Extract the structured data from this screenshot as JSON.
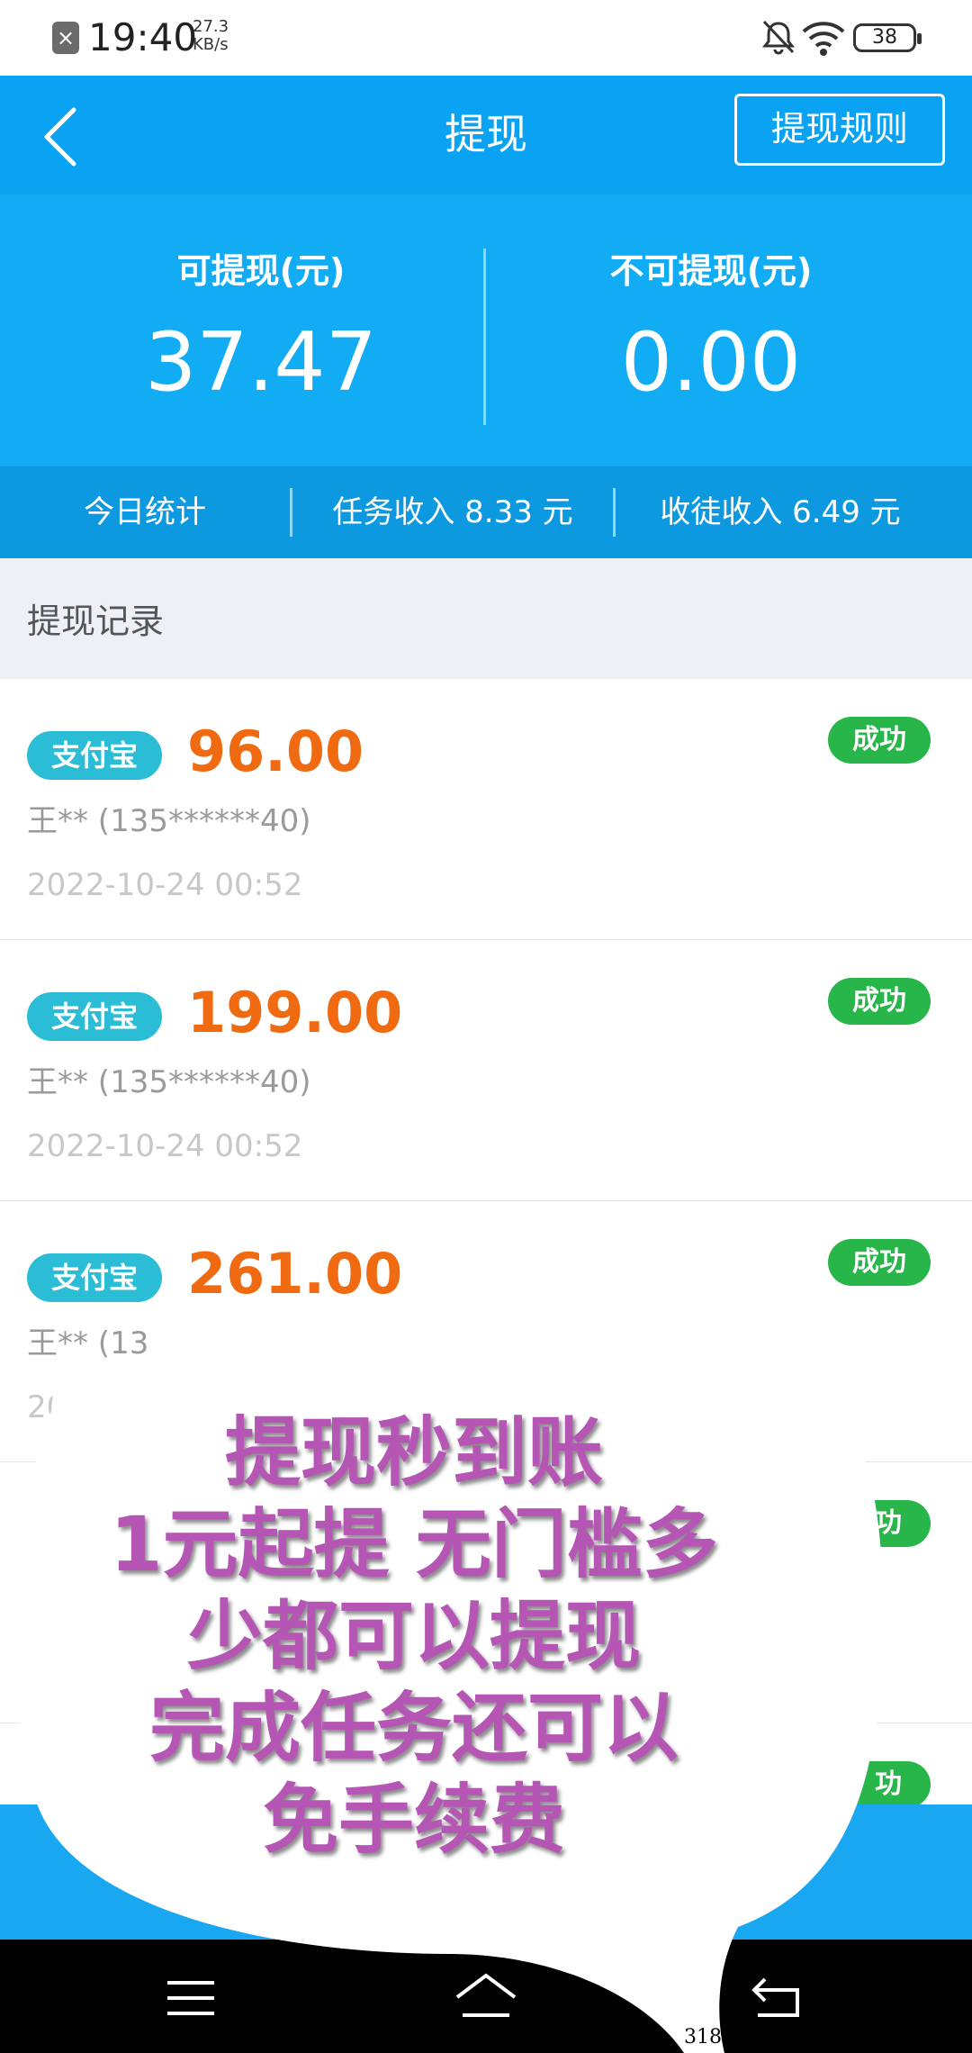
{
  "status_bar": {
    "time": "19:40",
    "speed_value": "27.3",
    "speed_unit": "KB/s",
    "battery": "38"
  },
  "header": {
    "title": "提现",
    "rules_button": "提现规则"
  },
  "balance": {
    "withdrawable_label": "可提现(元)",
    "withdrawable_value": "37.47",
    "non_withdrawable_label": "不可提现(元)",
    "non_withdrawable_value": "0.00"
  },
  "stats": {
    "today": "今日统计",
    "task_income": "任务收入 8.33 元",
    "apprentice_income": "收徒收入 6.49 元"
  },
  "records_title": "提现记录",
  "records": [
    {
      "method": "支付宝",
      "amount": "96.00",
      "name": "王** (135******40)",
      "time": "2022-10-24 00:52",
      "status": "成功"
    },
    {
      "method": "支付宝",
      "amount": "199.00",
      "name": "王** (135******40)",
      "time": "2022-10-24 00:52",
      "status": "成功"
    },
    {
      "method": "支付宝",
      "amount": "261.00",
      "name": "王** (13",
      "time": "20",
      "status": "成功"
    },
    {
      "status": "功"
    },
    {
      "status": "功"
    }
  ],
  "promo_lines": [
    "提现秒到账",
    "1元起提 无门槛多",
    "少都可以提现",
    "完成任务还可以",
    "免手续费"
  ],
  "corner_code": "318",
  "icons": {
    "back": "chevron-left-icon",
    "menu": "menu-icon",
    "home": "home-icon",
    "return": "return-icon"
  }
}
